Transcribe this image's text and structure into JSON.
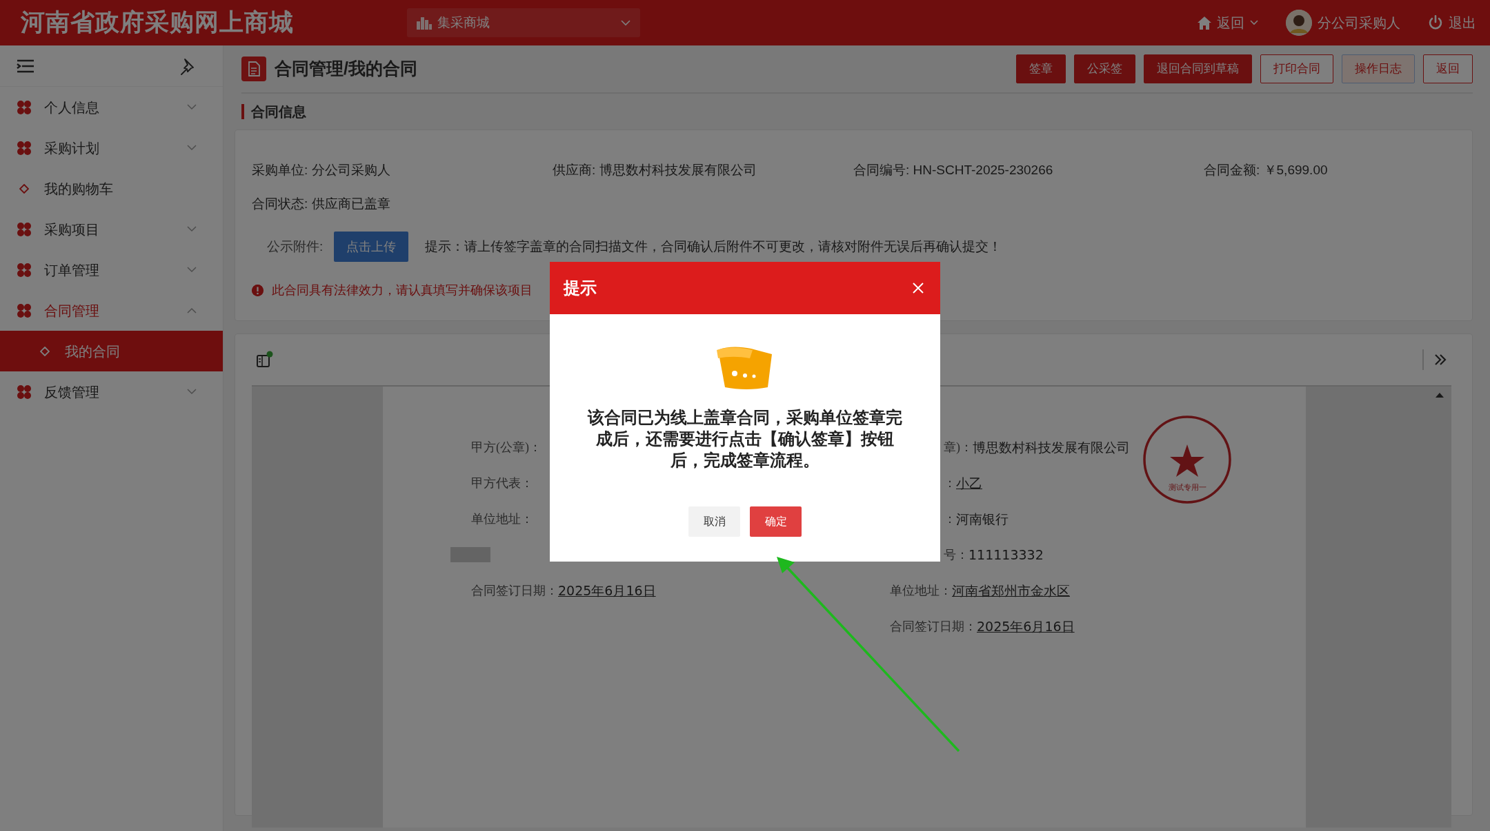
{
  "topbar": {
    "site_title": "河南省政府采购网上商城",
    "mall_select": {
      "value": "集采商城"
    },
    "back_menu": "返回",
    "user_name": "分公司采购人",
    "logout": "退出"
  },
  "sidebar": {
    "items": [
      {
        "label": "个人信息",
        "kind": "group",
        "expanded": false,
        "selected": false
      },
      {
        "label": "采购计划",
        "kind": "group",
        "expanded": false,
        "selected": false
      },
      {
        "label": "我的购物车",
        "kind": "link",
        "selected": false
      },
      {
        "label": "采购项目",
        "kind": "group",
        "expanded": false,
        "selected": false
      },
      {
        "label": "订单管理",
        "kind": "group",
        "expanded": false,
        "selected": false
      },
      {
        "label": "合同管理",
        "kind": "group",
        "expanded": true,
        "selected": false,
        "children": [
          {
            "label": "我的合同",
            "kind": "link",
            "selected": true
          }
        ]
      },
      {
        "label": "反馈管理",
        "kind": "group",
        "expanded": false,
        "selected": false
      }
    ]
  },
  "header": {
    "title": "合同管理/我的合同",
    "buttons": [
      {
        "label": "签章",
        "kind": "primary"
      },
      {
        "label": "公采签",
        "kind": "primary"
      },
      {
        "label": "退回合同到草稿",
        "kind": "primary"
      },
      {
        "label": "打印合同",
        "kind": "outline"
      },
      {
        "label": "操作日志",
        "kind": "light"
      },
      {
        "label": "返回",
        "kind": "outline"
      }
    ]
  },
  "section_title": "合同信息",
  "contract_info": {
    "fields": [
      "采购单位: 分公司采购人",
      "供应商: 博思数村科技发展有限公司",
      "合同编号: HN-SCHT-2025-230266",
      "合同金额: ￥5,699.00",
      "合同状态: 供应商已盖章"
    ],
    "attachment": {
      "label": "公示附件:",
      "upload_button": "点击上传",
      "hint": "提示：请上传签字盖章的合同扫描文件，合同确认后附件不可更改，请核对附件无误后再确认提交！"
    },
    "warning": "此合同具有法律效力，请认真填写并确保该项目"
  },
  "document": {
    "left_rows": [
      {
        "kind": "text",
        "label": "甲方(公章)："
      },
      {
        "kind": "text",
        "label": "甲方代表："
      },
      {
        "kind": "text",
        "label": "单位地址："
      },
      {
        "kind": "redacted"
      },
      {
        "kind": "text",
        "label": "合同签订日期：",
        "value": "2025年6月16日",
        "underlined": true
      }
    ],
    "right_rows": [
      {
        "kind": "text",
        "partial": true,
        "label": "章)：",
        "value": "博思数村科技发展有限公司",
        "underlined": false
      },
      {
        "kind": "text",
        "partial": true,
        "label": "：",
        "value": "小乙",
        "underlined": true
      },
      {
        "kind": "text",
        "partial": true,
        "label": "：",
        "value": "河南银行",
        "underlined": false
      },
      {
        "kind": "text",
        "partial": true,
        "label": "号：",
        "value": "111113332",
        "underlined": false
      },
      {
        "kind": "text",
        "partial": false,
        "label": "单位地址：",
        "value": "河南省郑州市金水区",
        "underlined": true
      },
      {
        "kind": "text",
        "partial": false,
        "label": "合同签订日期：",
        "value": "2025年6月16日",
        "underlined": true
      }
    ],
    "seal": {
      "text": "测试专用一"
    }
  },
  "dialog": {
    "title": "提示",
    "message": "该合同已为线上盖章合同，采购单位签章完成后，还需要进行点击【确认签章】按钮后，完成签章流程。",
    "buttons": [
      {
        "label": "取消",
        "kind": "secondary"
      },
      {
        "label": "确定",
        "kind": "primary"
      }
    ]
  }
}
